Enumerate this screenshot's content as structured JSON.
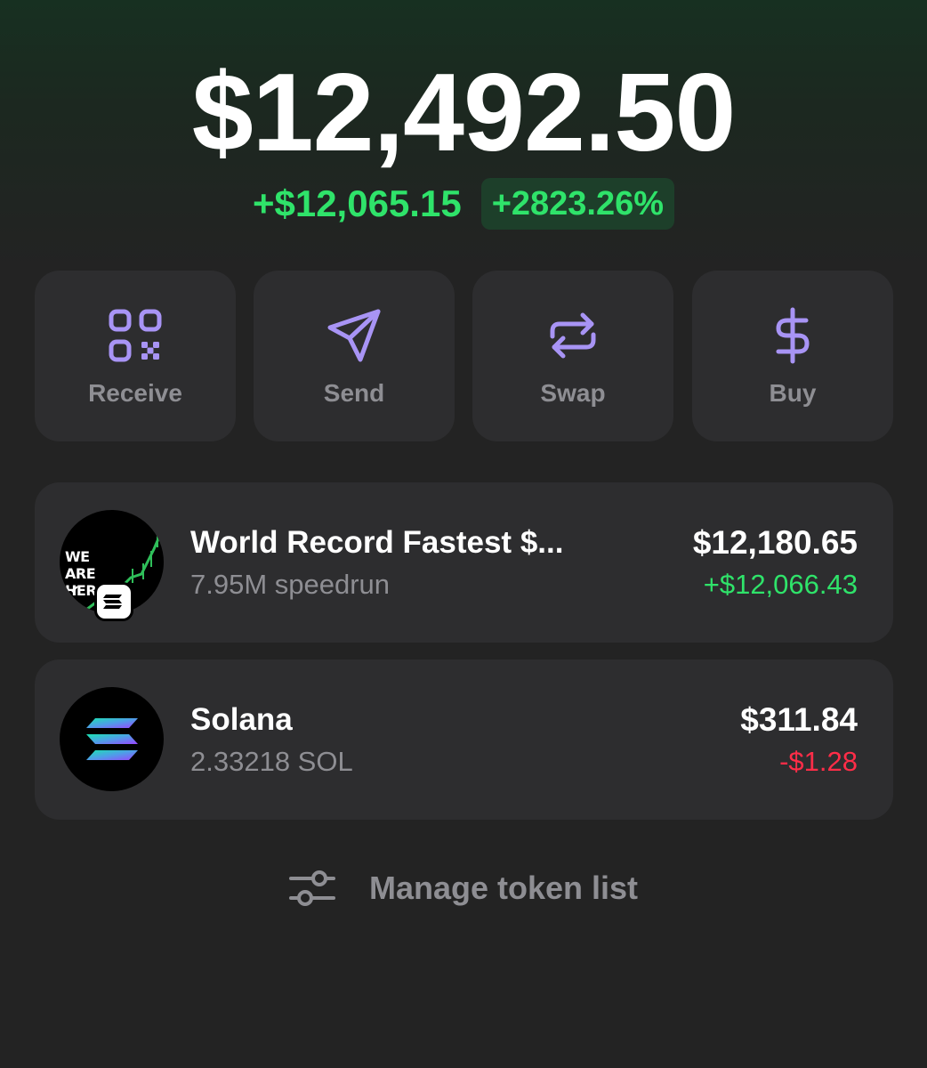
{
  "portfolio": {
    "balance": "$12,492.50",
    "change_abs": "+$12,065.15",
    "change_pct": "+2823.26%",
    "change_color": "#2fe36a"
  },
  "actions": [
    {
      "label": "Receive",
      "icon": "qr-code-icon"
    },
    {
      "label": "Send",
      "icon": "send-arrow-icon"
    },
    {
      "label": "Swap",
      "icon": "swap-arrows-icon"
    },
    {
      "label": "Buy",
      "icon": "dollar-icon"
    }
  ],
  "accent_color": "#a894f5",
  "tokens": [
    {
      "name": "World Record Fastest $...",
      "amount": "7.95M speedrun",
      "value": "$12,180.65",
      "delta": "+$12,066.43",
      "delta_color": "#2fe36a",
      "logo_text": "WE ARE HERE",
      "icon": "token-logo-icon"
    },
    {
      "name": "Solana",
      "amount": "2.33218 SOL",
      "value": "$311.84",
      "delta": "-$1.28",
      "delta_color": "#ff2d48",
      "icon": "solana-logo-icon"
    }
  ],
  "manage": {
    "label": "Manage token list",
    "icon": "sliders-icon"
  }
}
